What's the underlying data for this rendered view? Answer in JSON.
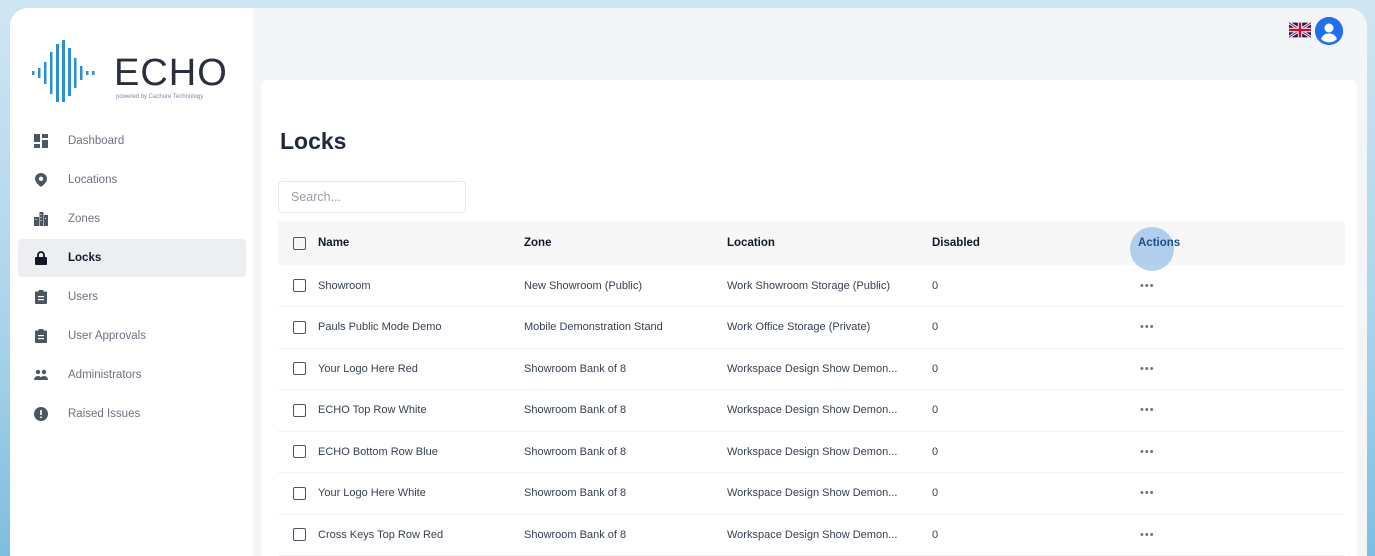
{
  "brand": {
    "name": "ECHO",
    "tagline": "powered by Cachure Technology"
  },
  "sidebar": {
    "items": [
      {
        "label": "Dashboard",
        "icon": "dashboard-icon"
      },
      {
        "label": "Locations",
        "icon": "map-pin-icon"
      },
      {
        "label": "Zones",
        "icon": "buildings-icon"
      },
      {
        "label": "Locks",
        "icon": "lock-icon",
        "active": true
      },
      {
        "label": "Users",
        "icon": "clipboard-icon"
      },
      {
        "label": "User Approvals",
        "icon": "clipboard-icon"
      },
      {
        "label": "Administrators",
        "icon": "people-icon"
      },
      {
        "label": "Raised Issues",
        "icon": "alert-icon"
      }
    ]
  },
  "topbar": {
    "language_icon": "uk-flag-icon",
    "profile_icon": "user-avatar-icon"
  },
  "page": {
    "title": "Locks",
    "search_placeholder": "Search..."
  },
  "table": {
    "headers": {
      "name": "Name",
      "zone": "Zone",
      "location": "Location",
      "disabled": "Disabled",
      "actions": "Actions"
    },
    "rows": [
      {
        "name": "Showroom",
        "zone": "New Showroom (Public)",
        "location": "Work Showroom Storage (Public)",
        "disabled": "0",
        "actions": "•••"
      },
      {
        "name": "Pauls Public Mode Demo",
        "zone": "Mobile Demonstration Stand",
        "location": "Work Office Storage (Private)",
        "disabled": "0",
        "actions": "•••"
      },
      {
        "name": "Your Logo Here Red",
        "zone": "Showroom Bank of 8",
        "location": "Workspace Design Show Demon...",
        "disabled": "0",
        "actions": "•••"
      },
      {
        "name": "ECHO Top Row White",
        "zone": "Showroom Bank of 8",
        "location": "Workspace Design Show Demon...",
        "disabled": "0",
        "actions": "•••"
      },
      {
        "name": "ECHO Bottom Row Blue",
        "zone": "Showroom Bank of 8",
        "location": "Workspace Design Show Demon...",
        "disabled": "0",
        "actions": "•••"
      },
      {
        "name": "Your Logo Here White",
        "zone": "Showroom Bank of 8",
        "location": "Workspace Design Show Demon...",
        "disabled": "0",
        "actions": "•••"
      },
      {
        "name": "Cross Keys Top Row Red",
        "zone": "Showroom Bank of 8",
        "location": "Workspace Design Show Demon...",
        "disabled": "0",
        "actions": "•••"
      }
    ]
  },
  "colors": {
    "brand_blue": "#1e6ff2",
    "logo_blue": "#2b8fd6",
    "active_nav_bg": "#eceef1"
  }
}
